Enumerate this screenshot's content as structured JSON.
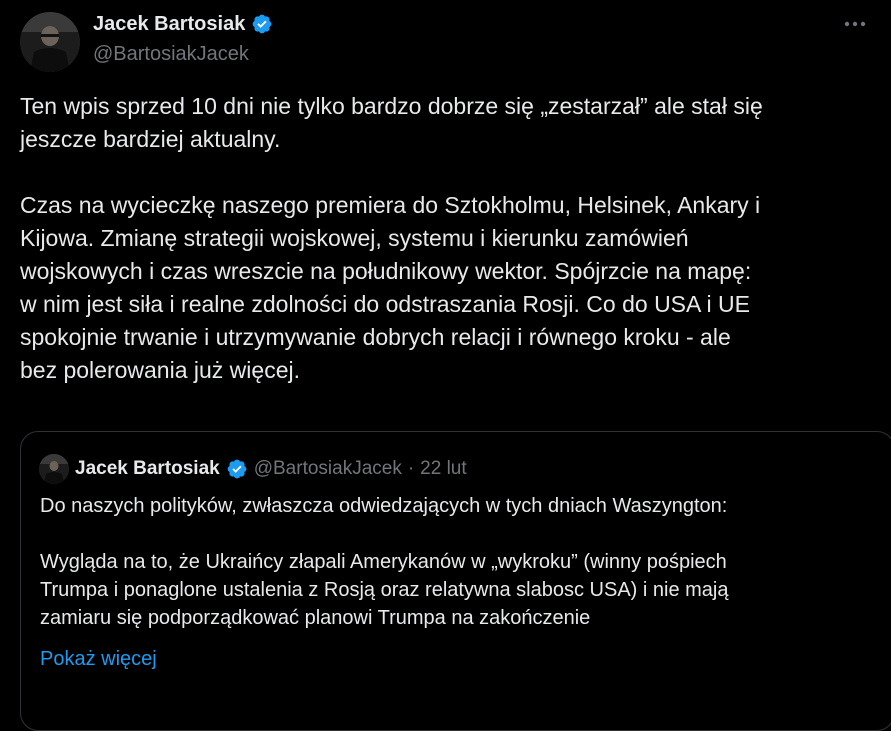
{
  "author": {
    "name": "Jacek Bartosiak",
    "handle": "@BartosiakJacek",
    "verified": true
  },
  "post": {
    "text": "Ten wpis sprzed 10 dni nie tylko bardzo dobrze się „zestarzał” ale stał się\njeszcze bardziej aktualny.\n\nCzas na wycieczkę naszego premiera do Sztokholmu, Helsinek, Ankary i\nKijowa. Zmianę strategii wojskowej, systemu i kierunku zamówień\nwojskowych i czas wreszcie na południkowy wektor. Spójrzcie na mapę:\nw nim jest siła i realne zdolności do odstraszania Rosji. Co do USA i UE\nspokojnie trwanie i utrzymywanie dobrych relacji i równego kroku - ale\nbez polerowania już więcej."
  },
  "quoted": {
    "name": "Jacek Bartosiak",
    "handle": "@BartosiakJacek",
    "separator": "·",
    "date": "22 lut",
    "text": "Do naszych polityków, zwłaszcza odwiedzających w tych dniach Waszyngton:\n\nWygląda na to, że Ukraińcy złapali Amerykanów w „wykroku” (winny pośpiech\nTrumpa i ponaglone ustalenia z Rosją oraz relatywna slabosc USA) i nie mają\nzamiaru się podporządkować planowi Trumpa na zakończenie",
    "show_more_label": "Pokaż więcej"
  },
  "icons": {
    "verified": "verified-badge-icon",
    "more": "more-horizontal-icon"
  },
  "colors": {
    "background": "#000000",
    "text": "#e7e9ea",
    "secondary": "#71767b",
    "accent": "#1d9bf0",
    "border": "#2f3336"
  }
}
